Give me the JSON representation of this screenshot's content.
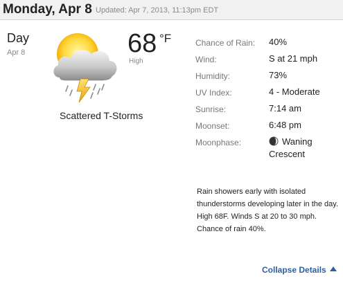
{
  "header": {
    "date": "Monday, Apr 8",
    "updated": "Updated: Apr 7, 2013, 11:13pm EDT"
  },
  "day": {
    "label": "Day",
    "date": "Apr 8",
    "temperature": "68",
    "unit": "°F",
    "temp_label": "High",
    "condition": "Scattered T-Storms",
    "icon": "scattered-tstorms-icon"
  },
  "details": [
    {
      "label": "Chance of Rain:",
      "value": "40%"
    },
    {
      "label": "Wind:",
      "value": "S at 21 mph"
    },
    {
      "label": "Humidity:",
      "value": "73%"
    },
    {
      "label": "UV Index:",
      "value": "4 - Moderate"
    },
    {
      "label": "Sunrise:",
      "value": "7:14 am"
    },
    {
      "label": "Moonset:",
      "value": "6:48 pm"
    },
    {
      "label": "Moonphase:",
      "value": "Waning",
      "value_line2": "Crescent",
      "icon": "moon-waning-crescent-icon"
    }
  ],
  "forecast_text": "Rain showers early with isolated thunderstorms developing later in the day. High 68F. Winds S at 20 to 30 mph. Chance of rain 40%.",
  "collapse_label": "Collapse Details",
  "colors": {
    "link": "#2e5f99",
    "header_bg": "#f1f1f1",
    "muted_text": "#888888"
  }
}
